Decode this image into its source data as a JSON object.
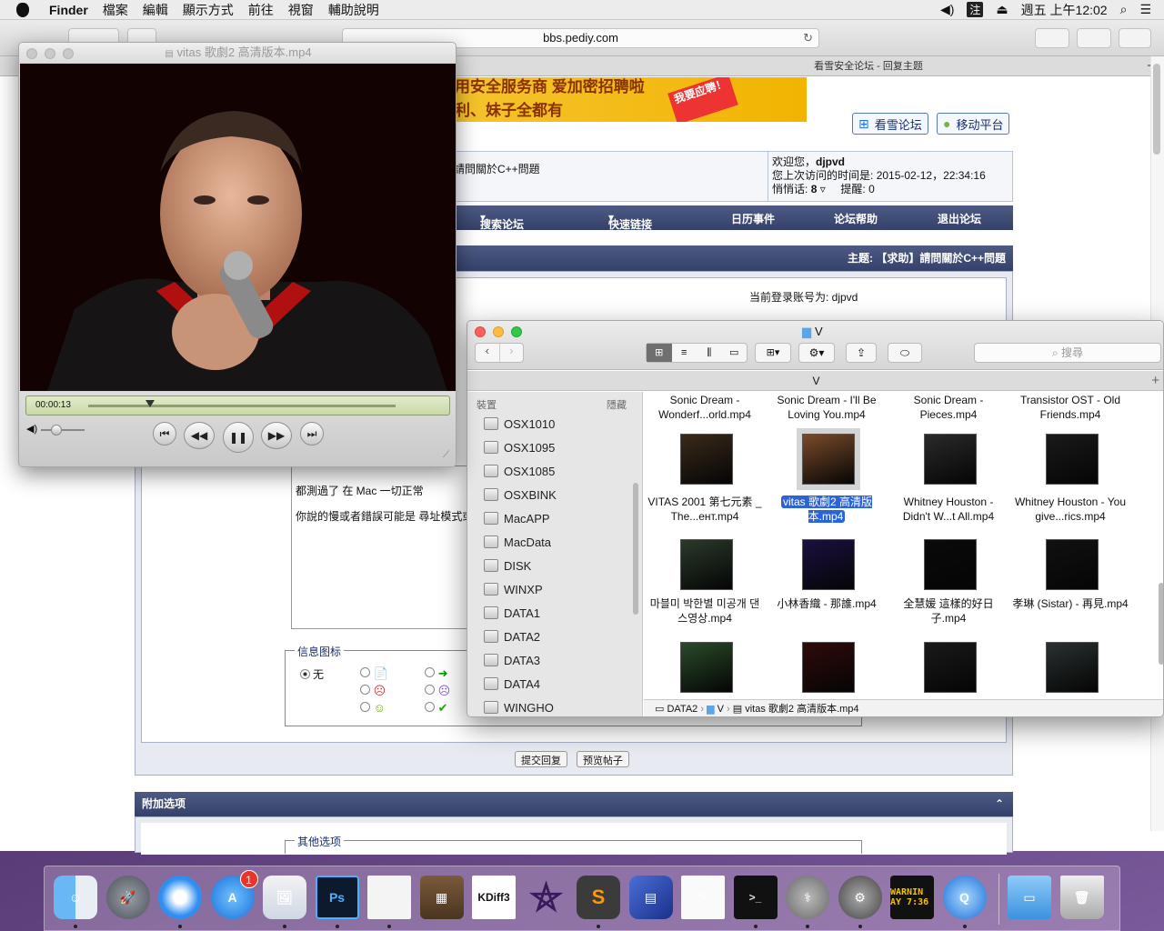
{
  "menubar": {
    "app": "Finder",
    "items": [
      "檔案",
      "編輯",
      "顯示方式",
      "前往",
      "視窗",
      "輔助說明"
    ],
    "clock": "週五 上午12:02",
    "ime": "注"
  },
  "safari": {
    "url": "bbs.pediy.com",
    "tab_title": "看雪安全论坛 - 回复主题"
  },
  "forum": {
    "banner_line1": "用安全服务商 爱加密招聘啦",
    "banner_line2": "利、妹子全都有",
    "banner_badge": "我要应聘！",
    "btn_kanxue": "看雪论坛",
    "btn_mobile": "移动平台",
    "thread_fragment": "請問關於C++問題",
    "welcome": "欢迎您，",
    "username": "djpvd",
    "last_visit_label": "您上次访问的时间是:",
    "last_visit": "2015-02-12，22:34:16",
    "pm_label": "悄悄话:",
    "pm_count": "8",
    "remind_label": "提醒:",
    "remind_count": "0",
    "nav": [
      "搜索论坛",
      "快速链接",
      "日历事件",
      "论坛帮助",
      "退出论坛"
    ],
    "topic_title": "主题: 【求助】請問關於C++問題",
    "login_account": "当前登录账号为: djpvd",
    "editor_line1": "都測過了 在 Mac 一切正常",
    "editor_line2": "你說的慢或者錯誤可能是 尋址模式或",
    "icon_legend": "信息图标",
    "icon_none": "无",
    "submit_label": "提交回复",
    "preview_label": "预览帖子",
    "attach_title": "附加选项",
    "other_options": "其他选项"
  },
  "video": {
    "title": "vitas 歌劇2 高清版本.mp4",
    "time": "00:00:13",
    "progress": 0.2,
    "volume": 0.35
  },
  "finder": {
    "title": "V",
    "path_title": "V",
    "search_placeholder": "搜尋",
    "sidebar_header": "裝置",
    "sidebar_hide": "隱藏",
    "devices": [
      "OSX1010",
      "OSX1095",
      "OSX1085",
      "OSXBINK",
      "MacAPP",
      "MacData",
      "DISK",
      "WINXP",
      "DATA1",
      "DATA2",
      "DATA3",
      "DATA4",
      "WINGHO"
    ],
    "files_row0": [
      "Sonic Dream - Wonderf...orld.mp4",
      "Sonic Dream - I'll Be Loving You.mp4",
      "Sonic Dream - Pieces.mp4",
      "Transistor OST - Old Friends.mp4"
    ],
    "files_row1": [
      "VITAS 2001 第七元素 _ The...ент.mp4",
      "vitas 歌劇2 高清版本.mp4",
      "Whitney Houston - Didn't W...t All.mp4",
      "Whitney Houston - You give...rics.mp4"
    ],
    "files_row2": [
      "마블미 박한별 미공개 댄스영상.mp4",
      "小林香織 - 那誰.mp4",
      "全慧媛 這樣的好日子.mp4",
      "孝琳 (Sistar) - 再見.mp4"
    ],
    "status_path": [
      "DATA2",
      "V",
      "vitas 歌劇2 高清版本.mp4"
    ]
  },
  "dock": {
    "appstore_badge": "1",
    "items": [
      "finder-icon",
      "launchpad-icon",
      "safari-icon",
      "app-store-icon",
      "preview-icon",
      "photoshop-icon",
      "textedit-icon",
      "calculator-icon",
      "kdiff3-icon",
      "pentagram-icon",
      "sublime-icon",
      "books-icon",
      "notes-icon",
      "terminal-icon",
      "disk-utility-icon",
      "system-prefs-icon",
      "console-icon",
      "quicktime-icon",
      "downloads-folder-icon",
      "trash-icon"
    ],
    "ps_label": "Ps",
    "kdiff_label": "KDiff3",
    "console_label": "WARNIN AY 7:36"
  }
}
